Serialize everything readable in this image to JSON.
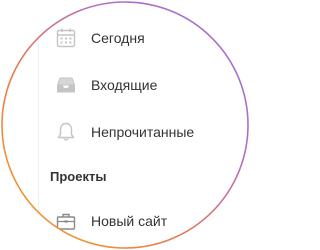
{
  "colors": {
    "ring_gradient": [
      "#f0a52a",
      "#ea7d4c",
      "#b46ec4",
      "#9872d0"
    ],
    "icon_color": "#c4c4c4",
    "text_color": "#333333"
  },
  "sidebar": {
    "items": [
      {
        "icon": "calendar-icon",
        "label": "Сегодня"
      },
      {
        "icon": "inbox-tray-icon",
        "label": "Входящие"
      },
      {
        "icon": "bell-icon",
        "label": "Непрочитанные"
      }
    ],
    "projects_heading": "Проекты",
    "projects": [
      {
        "icon": "briefcase-icon",
        "label": "Новый сайт"
      }
    ]
  }
}
